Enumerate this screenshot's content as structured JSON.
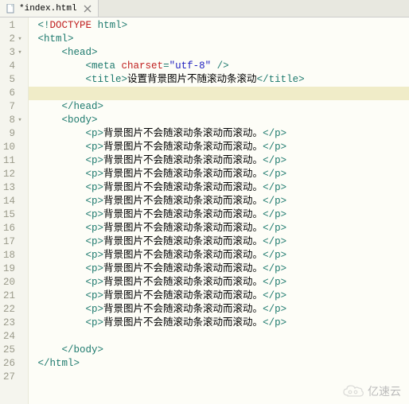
{
  "tab": {
    "filename": "*index.html"
  },
  "code": {
    "doctype_open": "<!",
    "doctype_word": "DOCTYPE",
    "doctype_rest": " html",
    "doctype_close": ">",
    "html_open": "<html>",
    "head_open": "<head>",
    "meta_open": "<meta ",
    "meta_attr": "charset",
    "meta_eq": "=",
    "meta_val": "\"utf-8\"",
    "meta_close": " />",
    "title_open": "<title>",
    "title_text": "设置背景图片不随滚动条滚动",
    "title_close": "</title>",
    "head_close": "</head>",
    "body_open": "<body>",
    "p_open": "<p>",
    "p_text": "背景图片不会随滚动条滚动而滚动。",
    "p_close": "</p>",
    "body_close": "</body>",
    "html_close": "</html>"
  },
  "lines": {
    "total": 27,
    "fold_lines": [
      2,
      3,
      8
    ],
    "highlighted_line": 6,
    "p_repeat_start": 9,
    "p_repeat_end": 23
  },
  "watermark": {
    "text": "亿速云"
  }
}
